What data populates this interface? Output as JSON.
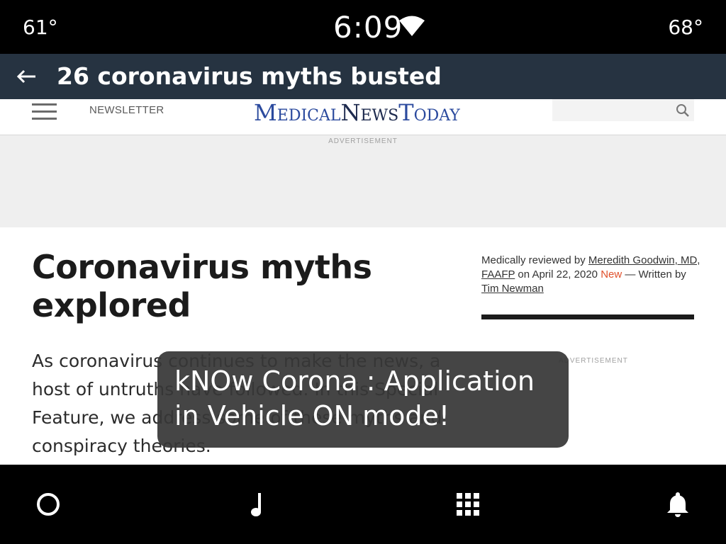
{
  "status_bar": {
    "temp_left": "61°",
    "time": "6:09",
    "temp_right": "68°",
    "wifi_icon": "wifi-icon"
  },
  "title_bar": {
    "back_icon": "back-arrow-icon",
    "title": "26 coronavirus myths busted"
  },
  "site_header": {
    "menu_icon": "hamburger-menu-icon",
    "newsletter": "NEWSLETTER",
    "logo": {
      "part1_cap": "M",
      "part1_rest": "EDICAL",
      "part2_cap": "N",
      "part2_rest": "EWS",
      "part3_cap": "T",
      "part3_rest": "ODAY"
    },
    "search_placeholder": "",
    "search_icon": "search-icon"
  },
  "ad": {
    "label": "ADVERTISEMENT"
  },
  "article": {
    "title": "Coronavirus myths explored",
    "intro": "As coronavirus continues to make the news, a host of untruths have followed. In this Special Feature, we address some of these myths and conspiracy theories.",
    "byline": {
      "prefix": "Medically reviewed by",
      "reviewer": "Meredith Goodwin, MD, FAAFP",
      "on_date": "on April 22, 2020",
      "new_badge": "New",
      "dash": "—",
      "written_by": "Written by",
      "author": "Tim Newman"
    },
    "side_ad_label": "ADVERTISEMENT"
  },
  "toast": {
    "message": "kNOw Corona : Application in Vehicle ON mode!"
  },
  "nav_bar": {
    "home_icon": "home-circle-icon",
    "music_icon": "music-note-icon",
    "apps_icon": "app-grid-icon",
    "notifications_icon": "bell-icon"
  },
  "colors": {
    "title_bar_bg": "#263341",
    "logo_blue": "#2b4a9e",
    "new_badge": "#e0502b"
  }
}
